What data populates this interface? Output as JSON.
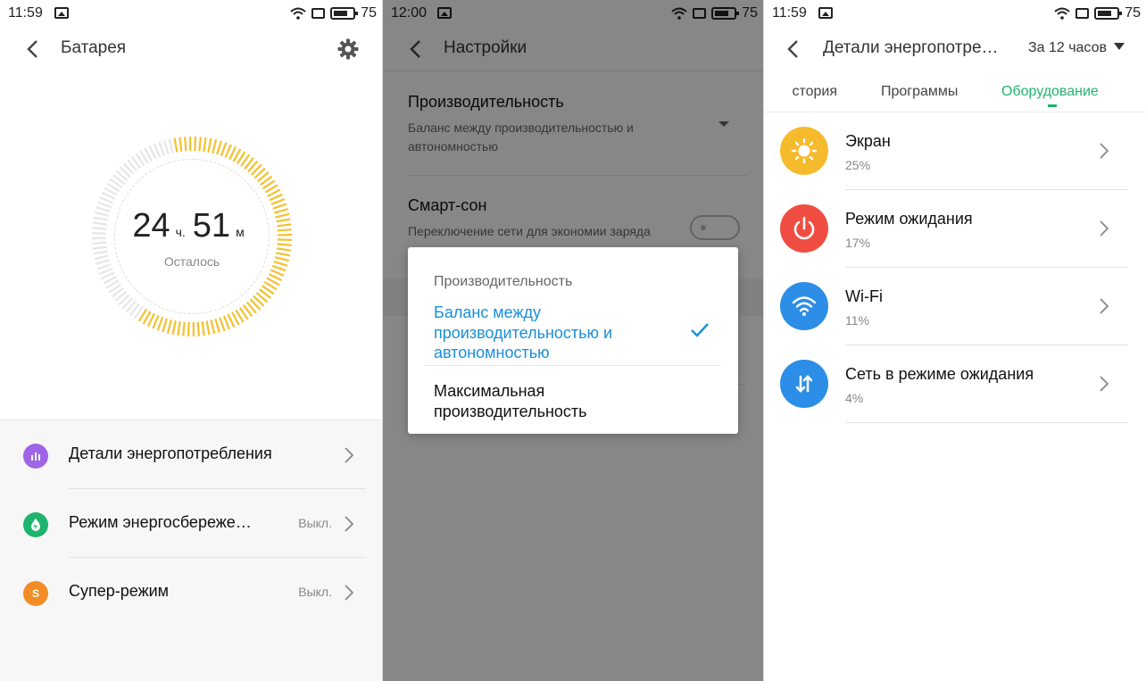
{
  "colors": {
    "accent_blue": "#1a8fd8",
    "accent_green": "#1fb46e",
    "dial_yellow": "#f5c02e",
    "dial_grey": "#e6e6e6",
    "details_purple": "#a064e6",
    "saving_green": "#1fb46e",
    "super_orange": "#f28d26",
    "screen_yellow": "#f6bb2c",
    "standby_red": "#f04d42",
    "wifi_blue": "#2c8ee6",
    "network_blue": "#2c8ee6"
  },
  "screen1": {
    "status": {
      "time": "11:59",
      "battery": "75"
    },
    "title": "Батарея",
    "remaining": {
      "hours": "24",
      "hours_unit": "ч.",
      "minutes": "51",
      "minutes_unit": "м",
      "label": "Осталось"
    },
    "dial_fill_fraction": 0.62,
    "items": [
      {
        "label": "Детали энергопотребления",
        "value": "",
        "icon": "chart-icon"
      },
      {
        "label": "Режим энергосбереже…",
        "value": "Выкл.",
        "icon": "drop-icon"
      },
      {
        "label": "Супер-режим",
        "value": "Выкл.",
        "icon_letter": "S"
      }
    ]
  },
  "screen2": {
    "status": {
      "time": "12:00",
      "battery": "75"
    },
    "title": "Настройки",
    "performance": {
      "heading": "Производительность",
      "subtitle": "Баланс между производительностью и автономностью"
    },
    "smart_sleep": {
      "heading": "Смарт-сон",
      "subtitle": "Переключение сети для экономии заряда"
    },
    "dialog": {
      "title": "Производительность",
      "options": [
        {
          "label": "Баланс между производительностью и автономностью",
          "selected": true
        },
        {
          "label": "Максимальная производительность",
          "selected": false
        }
      ]
    }
  },
  "screen3": {
    "status": {
      "time": "11:59",
      "battery": "75"
    },
    "title": "Детали энергопотре…",
    "period": "За 12 часов",
    "tabs": [
      {
        "label": "стория",
        "active": false
      },
      {
        "label": "Программы",
        "active": false
      },
      {
        "label": "Оборудование",
        "active": true
      }
    ],
    "items": [
      {
        "label": "Экран",
        "percent": "25%",
        "icon": "sun-icon"
      },
      {
        "label": "Режим ожидания",
        "percent": "17%",
        "icon": "power-icon"
      },
      {
        "label": "Wi-Fi",
        "percent": "11%",
        "icon": "wifi-icon"
      },
      {
        "label": "Сеть в режиме ожидания",
        "percent": "4%",
        "icon": "updown-arrows-icon"
      }
    ]
  }
}
